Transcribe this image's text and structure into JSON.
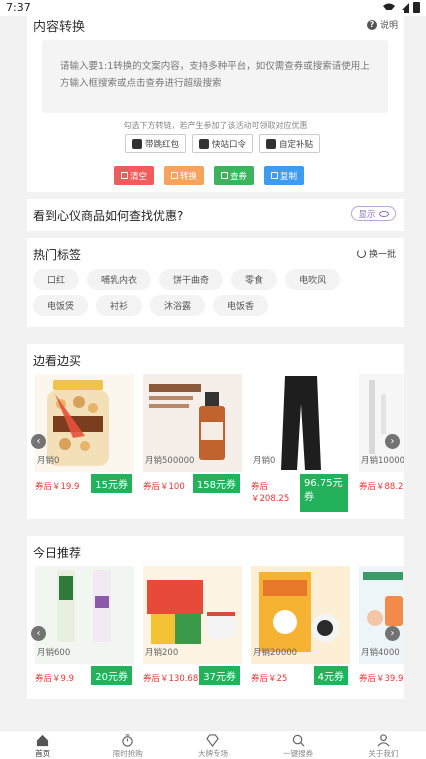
{
  "status": {
    "time": "7:37"
  },
  "convert": {
    "title": "内容转换",
    "help_label": "说明",
    "help_icon": "question-icon",
    "input_placeholder": "请输入要1:1转换的文案内容，支持多种平台，如仅需查券或搜索请使用上方输入框搜索或点击查券进行超级搜索",
    "hint": "勾选下方转链，若产生参加了该活动可领取对应优惠",
    "tools": [
      {
        "label": "带跳红包",
        "icon": "redpacket-icon"
      },
      {
        "label": "快站口令",
        "icon": "bolt-icon"
      },
      {
        "label": "自定补贴",
        "icon": "edit-icon"
      }
    ],
    "actions": [
      {
        "label": "清空",
        "color": "#f15b5b",
        "icon": "trash-icon"
      },
      {
        "label": "转换",
        "color": "#f7a35c",
        "icon": "convert-icon"
      },
      {
        "label": "查券",
        "color": "#3bb55d",
        "icon": "coupon-icon"
      },
      {
        "label": "复制",
        "color": "#3d9bf0",
        "icon": "copy-icon"
      }
    ]
  },
  "howto": {
    "text": "看到心仪商品如何查找优惠?",
    "show_label": "显示",
    "show_icon": "eye-icon"
  },
  "hottags": {
    "title": "热门标签",
    "refresh_label": "换一批",
    "tags": [
      "口红",
      "哺乳内衣",
      "饼干曲奇",
      "零食",
      "电吹风",
      "电饭煲",
      "衬衫",
      "沐浴露",
      "电饭香"
    ]
  },
  "browse": {
    "title": "边看边买",
    "products": [
      {
        "sales": "月销0",
        "after": "券后￥19.9",
        "coupon": "15元券",
        "color": "#f3e2c7"
      },
      {
        "sales": "月销500000",
        "after": "券后￥100",
        "coupon": "158元券",
        "color": "#f6efe9"
      },
      {
        "sales": "月销0",
        "after": "券后",
        "after_price": "￥208.25",
        "coupon": "96.75元券",
        "color": "#ffffff"
      },
      {
        "sales": "月销10000",
        "after": "券后￥88.2",
        "coupon": "",
        "color": "#f6f6f6"
      }
    ]
  },
  "today": {
    "title": "今日推荐",
    "products": [
      {
        "sales": "月销600",
        "after": "券后￥9.9",
        "coupon": "20元券",
        "color": "#f2f6f0"
      },
      {
        "sales": "月销200",
        "after": "券后￥130.68",
        "coupon": "37元券",
        "color": "#fdf3e2"
      },
      {
        "sales": "月销20000",
        "after": "券后￥25",
        "coupon": "4元券",
        "color": "#fcefd6"
      },
      {
        "sales": "月销4000",
        "after": "券后￥39.9",
        "coupon": "",
        "color": "#eef5f8"
      }
    ]
  },
  "nav": [
    {
      "label": "首页",
      "icon": "home-icon",
      "active": true
    },
    {
      "label": "限时抢购",
      "icon": "stopwatch-icon",
      "active": false
    },
    {
      "label": "大牌专场",
      "icon": "diamond-icon",
      "active": false
    },
    {
      "label": "一键搜券",
      "icon": "search-icon",
      "active": false
    },
    {
      "label": "关于我们",
      "icon": "person-icon",
      "active": false
    }
  ]
}
